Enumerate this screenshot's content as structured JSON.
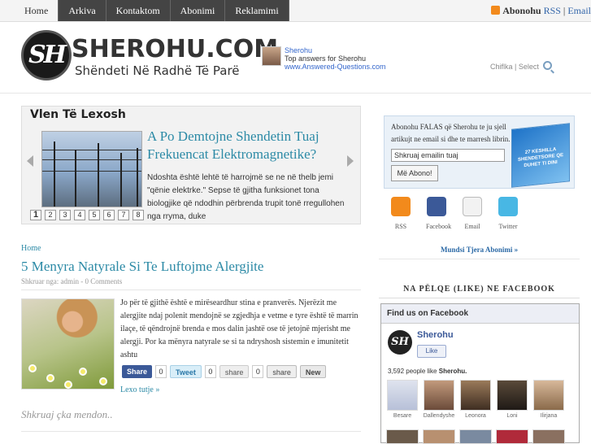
{
  "nav": {
    "items": [
      {
        "label": "Home",
        "active": true
      },
      {
        "label": "Arkiva",
        "active": false
      },
      {
        "label": "Kontaktom",
        "active": false
      },
      {
        "label": "Abonimi",
        "active": false
      },
      {
        "label": "Reklamimi",
        "active": false
      }
    ]
  },
  "topbar": {
    "subscribe_label": "Abonohu",
    "rss_label": "RSS",
    "separator": "|",
    "email_label": "Email"
  },
  "header": {
    "logo_letters": "SH",
    "logo_text": "SHEROHU.COM",
    "tagline": "Shëndeti Në Radhë Të Parë",
    "answers_name": "Sherohu",
    "answers_text": "Top answers for Sherohu",
    "answers_link": "www.Answered-Questions.com",
    "search_placeholder": "Chiflka | Select"
  },
  "slider": {
    "title": "Vlen Të Lexosh",
    "headline": "A Po Demtojne Shendetin Tuaj Frekuencat Elektromagnetike?",
    "excerpt": "Ndoshta është lehtë të harrojmë se ne në thelb jemi \"qënie elektrke.\" Sepse të gjitha funksionet tona biologjike që ndodhin përbrenda trupit tonë rregullohen nga rryma, duke",
    "pages": [
      "1",
      "2",
      "3",
      "4",
      "5",
      "6",
      "7",
      "8"
    ],
    "active_page": "1"
  },
  "post": {
    "breadcrumb": "Home",
    "title": "5 Menyra Natyrale Si Te Luftojme Alergjite",
    "meta": "Shkruar nga: admin - 0 Comments",
    "body": "Jo për të gjithë është e mirëseardhur stina e pranverës. Njerëzit me alergjite ndaj polenit mendojnë se zgjedhja e vetme e tyre është të marrin ilaçe, të qëndrojnë brenda e mos dalin jashtë ose të jetojnë mjerisht me alergji. Por ka mënyra natyrale se si ta ndryshosh sistemin e imunitetit ashtu",
    "share": {
      "fb_label": "Share",
      "fb_count": "0",
      "tw_label": "Tweet",
      "tw_count": "0",
      "gr_label": "share",
      "gr_count": "0",
      "dk_label": "share",
      "new_label": "New"
    },
    "more_label": "Lexo tutje »",
    "comment_placeholder": "Shkruaj çka mendon.."
  },
  "sidebar": {
    "subscribe_text": "Abonohu FALAS që Sherohu te ju sjell artikujt ne email si dhe te marresh librin.",
    "email_placeholder": "Shkruaj emailin tuaj",
    "subscribe_button": "Më Abono!",
    "ebook_label": "27 KESHILLA SHENDETSORE QE DUHET TI DINI",
    "icons": [
      {
        "icon": "rss-icon",
        "label": "RSS"
      },
      {
        "icon": "facebook-icon",
        "label": "Facebook"
      },
      {
        "icon": "email-icon",
        "label": "Email"
      },
      {
        "icon": "twitter-icon",
        "label": "Twitter"
      }
    ],
    "more_subscriptions": "Mundsi Tjera Abonimi »",
    "like_title": "NA PËLQE (LIKE) NE FACEBOOK",
    "fb": {
      "head": "Find us on Facebook",
      "page_name": "Sherohu",
      "like_button": "Like",
      "count_text": "3,592 people like",
      "count_page": "Sherohu.",
      "faces": [
        "Besare",
        "Dallendyshe",
        "Leonora",
        "Loni",
        "Ilirjana"
      ]
    }
  },
  "colors": {
    "accent": "#2c8aa6",
    "nav_bg": "#444444",
    "facebook": "#3b5998",
    "rss": "#f28a1c",
    "twitter": "#48b7e4"
  }
}
